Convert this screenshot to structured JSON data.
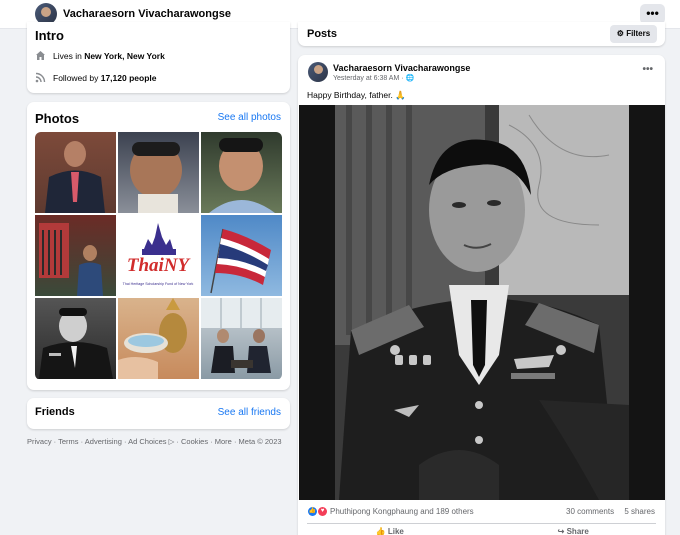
{
  "header": {
    "name": "Vacharaesorn Vivacharawongse",
    "more": "•••"
  },
  "intro": {
    "title": "Intro",
    "lives_prefix": "Lives in ",
    "lives_city": "New York, New York",
    "followed_prefix": "Followed by ",
    "followers": "17,120 people"
  },
  "photos": {
    "title": "Photos",
    "see_all": "See all photos",
    "items": [
      "Man in dark suit",
      "Selfie of man",
      "Smiling man",
      "Man in shop with umbrellas",
      "ThaiNY logo",
      "Thai flag",
      "Portrait in uniform",
      "Hands with water bowl",
      "Meeting in office"
    ],
    "logo_text": "ThaiNY",
    "logo_sub": "Thai Heritage Scholarship Fund of New York"
  },
  "friends": {
    "title": "Friends",
    "see_all": "See all friends"
  },
  "footer": "Privacy · Terms · Advertising · Ad Choices ▷ · Cookies · More · Meta © 2023",
  "posts": {
    "title": "Posts",
    "filters": "Filters"
  },
  "post": {
    "author": "Vacharaesorn Vivacharawongse",
    "time": "Yesterday at 6:38 AM · 🌐",
    "more": "•••",
    "text": "Happy Birthday, father. 🙏",
    "reactors": "Phuthipong Kongphaung and 189 others",
    "comments": "30 comments",
    "shares": "5 shares",
    "like": "Like",
    "share": "Share"
  },
  "colors": {
    "link": "#1877f2",
    "background": "#f0f2f5",
    "card": "#ffffff",
    "like": "#1877f2",
    "love": "#f33e58"
  }
}
